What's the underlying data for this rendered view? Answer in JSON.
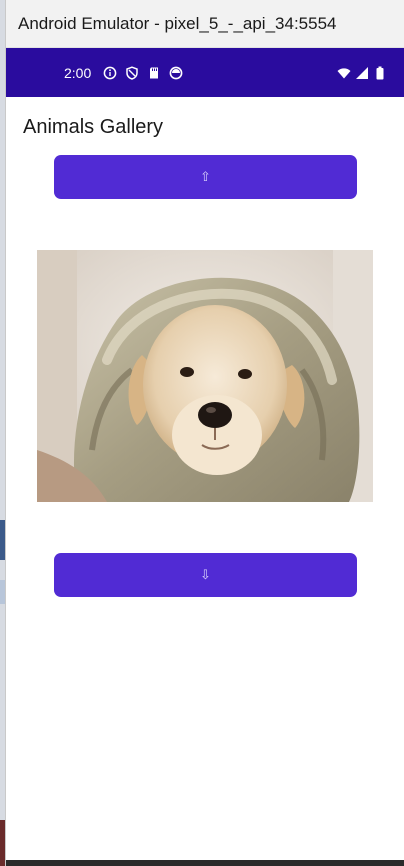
{
  "window": {
    "title": "Android Emulator - pixel_5_-_api_34:5554"
  },
  "status_bar": {
    "time": "2:00",
    "left_icons": [
      "info-icon",
      "shield-icon",
      "sd-card-icon",
      "circle-icon"
    ],
    "right_icons": [
      "wifi-icon",
      "signal-icon",
      "battery-icon"
    ],
    "color": "#2a0c9e"
  },
  "app": {
    "title": "Animals Gallery",
    "up_button_label": "⇧",
    "down_button_label": "⇩",
    "accent": "#512bd4",
    "image_icon": "puppy-photo"
  }
}
